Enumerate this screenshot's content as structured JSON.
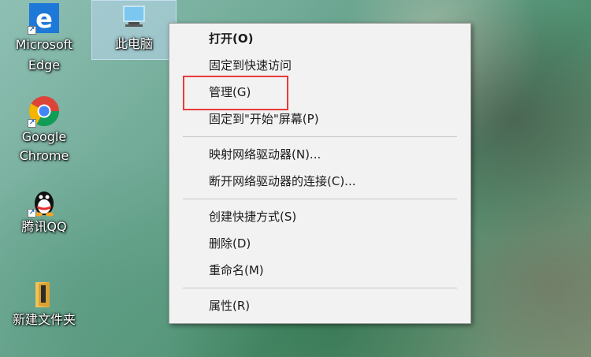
{
  "desktop": {
    "icons": [
      {
        "label": "Microsoft Edge",
        "icon": "edge-icon"
      },
      {
        "label": "此电脑",
        "icon": "this-pc-icon",
        "selected": true
      },
      {
        "label": "Google Chrome",
        "icon": "chrome-icon"
      },
      {
        "label": "腾讯QQ",
        "icon": "qq-icon"
      },
      {
        "label": "新建文件夹",
        "icon": "folder-icon"
      }
    ]
  },
  "context_menu": {
    "groups": [
      [
        "打开(O)",
        "固定到快速访问",
        "管理(G)",
        "固定到\"开始\"屏幕(P)"
      ],
      [
        "映射网络驱动器(N)...",
        "断开网络驱动器的连接(C)..."
      ],
      [
        "创建快捷方式(S)",
        "删除(D)",
        "重命名(M)"
      ],
      [
        "属性(R)"
      ]
    ],
    "highlighted_item": "管理(G)",
    "highlight_color": "#e83b3b"
  }
}
